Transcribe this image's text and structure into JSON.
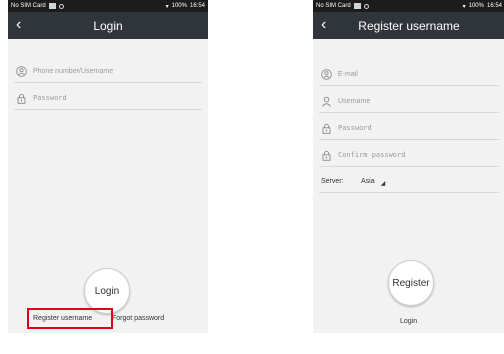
{
  "status_bar": {
    "carrier": "No SIM Card",
    "battery": "100%",
    "time": "16:54"
  },
  "login_screen": {
    "title": "Login",
    "username_placeholder": "Phone number/Username",
    "password_placeholder": "Password",
    "login_button": "Login",
    "register_link": "Register username",
    "forgot_link": "Forgot password"
  },
  "register_screen": {
    "title": "Register username",
    "email_placeholder": "E-mail",
    "username_placeholder": "Username",
    "password_placeholder": "Password",
    "confirm_placeholder": "Confirm password",
    "server_label": "Server:",
    "server_value": "Asia",
    "register_button": "Register",
    "login_link": "Login"
  },
  "colors": {
    "titlebar": "#30353b",
    "statusbar": "#1c1c1c",
    "highlight": "#e0001b"
  },
  "icons": [
    "back-arrow-icon",
    "user-circle-icon",
    "lock-icon",
    "email-icon",
    "person-icon",
    "dropdown-caret-icon"
  ]
}
